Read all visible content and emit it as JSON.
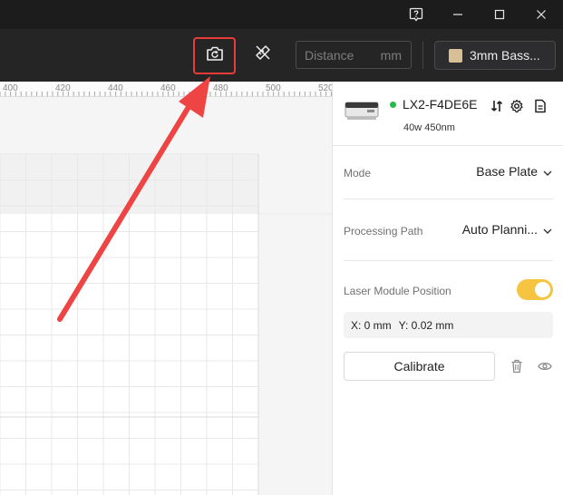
{
  "titlebar": {
    "help_icon": "help-question-icon",
    "minimize_icon": "minimize-icon",
    "maximize_icon": "maximize-icon",
    "close_icon": "close-icon"
  },
  "toolbar": {
    "camera_icon": "camera-refresh-icon",
    "measure_icon": "ruler-pencil-icon",
    "distance_placeholder": "Distance",
    "distance_unit": "mm",
    "material_label": "3mm Bass...",
    "material_color": "#d8bf96",
    "highlight_color": "#ea3b3b"
  },
  "ruler": {
    "ticks": [
      "400",
      "420",
      "440",
      "460",
      "480",
      "500",
      "520"
    ]
  },
  "device": {
    "name": "LX2-F4DE6E",
    "spec": "40w 450nm",
    "status_color": "#27b94b"
  },
  "settings": {
    "mode_label": "Mode",
    "mode_value": "Base Plate",
    "path_label": "Processing Path",
    "path_value": "Auto Planni...",
    "laser_label": "Laser Module Position",
    "laser_enabled": true,
    "toggle_color": "#f5c542",
    "coord_x": "X: 0 mm",
    "coord_y": "Y: 0.02 mm",
    "calibrate_label": "Calibrate"
  },
  "annotation": {
    "arrow_color": "#ef4444"
  }
}
